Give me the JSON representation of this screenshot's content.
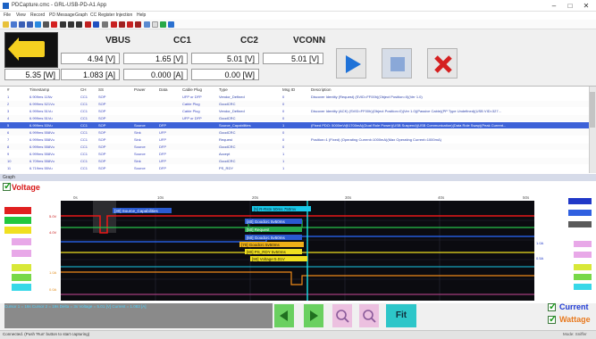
{
  "window": {
    "title": "PDCapture.cmc - GRL-USB-PD-A1 App",
    "min_icon": "minimize-icon",
    "max_icon": "maximize-icon",
    "close_icon": "close-icon",
    "min_glyph": "–",
    "max_glyph": "□",
    "close_glyph": "✕"
  },
  "menu": [
    "File",
    "View",
    "Record",
    "PD Message",
    "Graph",
    "CC Register Injection",
    "Help"
  ],
  "toolbar_icons": [
    "new-icon",
    "open-icon",
    "save-icon",
    "save-as-icon",
    "play-icon",
    "stop-icon",
    "clear-icon",
    "filter-icon",
    "filter-icon",
    "filter-icon",
    "text-icon",
    "text-icon",
    "settings-icon",
    "record-icon",
    "record-icon",
    "record-icon",
    "record-icon",
    "settings-icon",
    "refresh-icon",
    "info-icon",
    "help-icon"
  ],
  "measurements": {
    "vbus": {
      "label": "VBUS",
      "volts": "4.94 [V]",
      "amps": "5.35 [W]"
    },
    "cc1": {
      "label": "CC1",
      "volts": "1.65 [V]",
      "amps": "1.083 [A]"
    },
    "cc2": {
      "label": "CC2",
      "volts": "5.01 [V]",
      "amps": "0.000 [A]"
    },
    "vconn": {
      "label": "VCONN",
      "volts": "5.01 [V]",
      "amps": "0.00 [W]"
    }
  },
  "controls": {
    "play_icon": "play-icon",
    "stop_icon": "stop-icon",
    "clear_icon": "clear-icon",
    "play_color": "#1f72d8",
    "clear_color": "#d52020"
  },
  "table": {
    "columns": [
      "#",
      "Timestamp",
      "CH",
      "SS",
      "Power",
      "Data",
      "Cable Plug",
      "Type",
      "Msg ID",
      "Description"
    ],
    "rows": [
      [
        "1",
        "6.909ms 11Nv",
        "CC1",
        "SOP",
        "",
        "",
        "UFP or DFP",
        "Vendor_Defined",
        "0",
        "Discover Identity (Request) (SVID=FF00h)(Object Position=0)(Ver 1.0)"
      ],
      [
        "2",
        "6.999ms 521Vu",
        "CC1",
        "SOP",
        "",
        "",
        "Cable Plug",
        "GoodCRC",
        "0",
        ""
      ],
      [
        "3",
        "6.999ms 51Vu",
        "CC1",
        "SOP",
        "",
        "",
        "Cable Plug",
        "Vendor_Defined",
        "0",
        "Discover Identity (ACK) (SVID=FF00h)(Object Position=0)(Ver 1.0)(Passive Cable)(PP Type Undefined)(USB VID=327..."
      ],
      [
        "4",
        "6.999ms 51Vu",
        "CC1",
        "SOP",
        "",
        "",
        "UFP or DFP",
        "GoodCRC",
        "0",
        ""
      ],
      [
        "5",
        "6.999ms 53Vu",
        "CC1",
        "SOP",
        "Source",
        "DFP",
        "",
        "Source_Capabilities",
        "1",
        "(Fixed PDO: 5000mV@1700mA)(Dual Role Power)(USB Suspend)(USB Communication)(Data Role Swap)(Peak Current..."
      ],
      [
        "6",
        "6.999ms 558Vu",
        "CC1",
        "SOP",
        "Sink",
        "UFP",
        "",
        "GoodCRC",
        "0",
        ""
      ],
      [
        "7",
        "6.999ms 558Vu",
        "CC1",
        "SOP",
        "Sink",
        "UFP",
        "",
        "Request",
        "0",
        "Position=1 (Fixed) (Operating Current=1000mA)(Max Operating Current=1000mA)"
      ],
      [
        "8",
        "6.999ms 558Vu",
        "CC1",
        "SOP",
        "Source",
        "DFP",
        "",
        "GoodCRC",
        "0",
        ""
      ],
      [
        "9",
        "6.999ms 558Vu",
        "CC1",
        "SOP",
        "Source",
        "DFP",
        "",
        "Accept",
        "1",
        ""
      ],
      [
        "10",
        "6.709ms 558Vu",
        "CC1",
        "SOP",
        "Sink",
        "UFP",
        "",
        "GoodCRC",
        "1",
        ""
      ],
      [
        "11",
        "6.719ms 55Vu",
        "CC1",
        "SOP",
        "Source",
        "DFP",
        "",
        "PS_RDY",
        "1",
        ""
      ]
    ]
  },
  "graph": {
    "panel_title": "Graph",
    "voltage_label": "Voltage",
    "current_label": "Current",
    "wattage_label": "Wattage",
    "axis_ticks": [
      "0s",
      "10s",
      "20s",
      "30s",
      "40s",
      "50s"
    ],
    "left_ticks": [
      "5.0V",
      "4.0V",
      "1.0A",
      "0.0A"
    ],
    "right_ticks": [
      "1.0A",
      "0.5A"
    ],
    "annotations": [
      "[30] Source_Capabilities",
      "[5] R-Rstn 50ms 750mv",
      "[40] Goodcrc 5v50ms",
      "[50] Request",
      "[60] Goodcrc 5v50ms",
      "[70] Goodcrc 5v50ms",
      "[80] PS_RDY 5v50ms",
      "[90] Voltage:5.01V"
    ],
    "colors": {
      "vbus": "#e81818",
      "cc1": "#f0e020",
      "cc2": "#18c8e8",
      "blue_line": "#2a6aff",
      "green_line": "#26c44a",
      "cursor": "#18e0e8"
    },
    "info_text": "Cursor 1 = 16s  Cursor 2 = 19s  Delta = 3s  Voltage = 5.01 [V]  Current = 1.083 [A]",
    "nav_prev_icon": "arrow-left-icon",
    "nav_next_icon": "arrow-right-icon",
    "zoom_in_icon": "zoom-in-icon",
    "zoom_out_icon": "zoom-out-icon",
    "fit_label": "Fit"
  },
  "status": {
    "left": "Connected. (Push 'Run' button to start capturing)",
    "right": "Mode: Sniffer"
  }
}
